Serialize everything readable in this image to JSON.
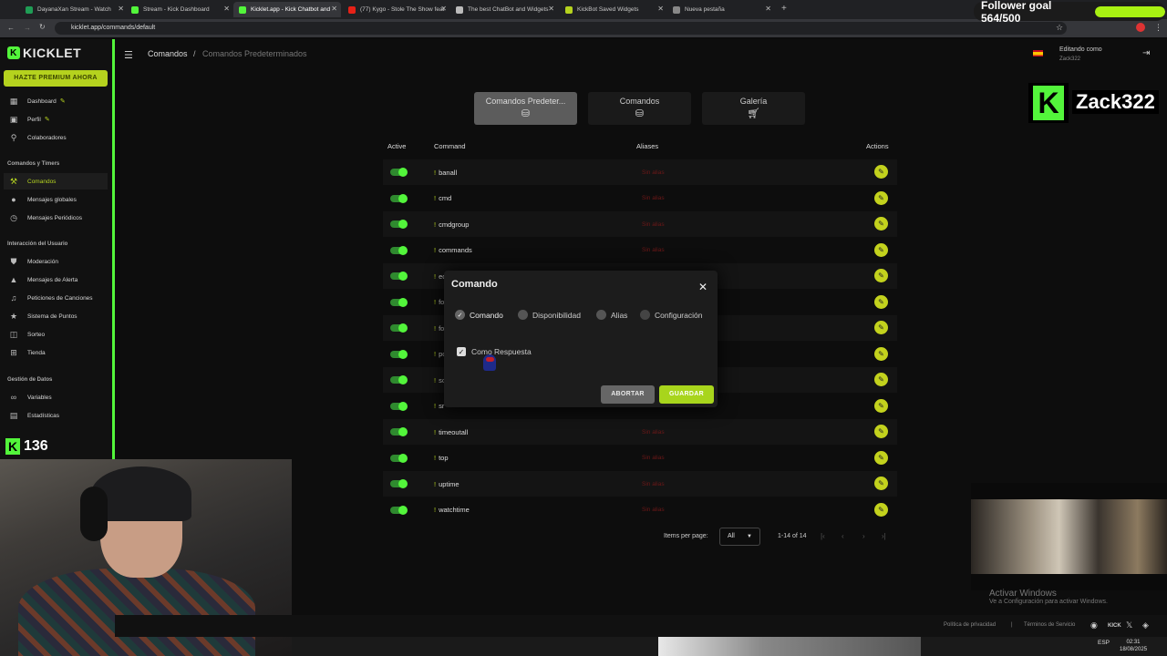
{
  "browser": {
    "tabs": [
      {
        "title": "DayanaXan Stream - Watch",
        "color": "#1f9d55"
      },
      {
        "title": "Stream - Kick Dashboard",
        "color": "#53f53b"
      },
      {
        "title": "Kicklet.app - Kick Chatbot and",
        "color": "#53f53b"
      },
      {
        "title": "(77) Kygo - Stole The Show feat",
        "color": "#e62117"
      },
      {
        "title": "The best ChatBot and Widgets",
        "color": "#bbbbbb"
      },
      {
        "title": "KickBot Saved Widgets",
        "color": "#b5d21e"
      },
      {
        "title": "Nueva pestaña",
        "color": "#888888"
      }
    ],
    "active_tab": 2,
    "url": "kicklet.app/commands/default"
  },
  "overlay": {
    "follower_goal_label": "Follower goal 564/500",
    "follower_goal_fraction": 1.0,
    "streamer_name": "Zack322",
    "kick_count": "136",
    "windows_activate_title": "Activar Windows",
    "windows_activate_sub": "Ve a Configuración para activar Windows."
  },
  "app": {
    "logo": "KICKLET",
    "premium_button": "HAZTE PREMIUM AHORA",
    "sidebar": {
      "items_top": [
        {
          "label": "Dashboard",
          "icon": "grid-icon"
        },
        {
          "label": "Perfil",
          "icon": "profile-icon"
        },
        {
          "label": "Colaboradores",
          "icon": "link-icon"
        }
      ],
      "section1": "Comandos y Timers",
      "items1": [
        {
          "label": "Comandos",
          "icon": "wrench-icon"
        },
        {
          "label": "Mensajes globales",
          "icon": "chat-icon"
        },
        {
          "label": "Mensajes Periódicos",
          "icon": "clock-icon"
        }
      ],
      "section2": "Interacción del Usuario",
      "items2": [
        {
          "label": "Moderación",
          "icon": "shield-icon"
        },
        {
          "label": "Mensajes de Alerta",
          "icon": "alert-icon"
        },
        {
          "label": "Peticiones de Canciones",
          "icon": "music-icon"
        },
        {
          "label": "Sistema de Puntos",
          "icon": "star-icon"
        },
        {
          "label": "Sorteo",
          "icon": "ticket-icon"
        },
        {
          "label": "Tienda",
          "icon": "cart-icon"
        }
      ],
      "section3": "Gestión de Datos",
      "items3": [
        {
          "label": "Variables",
          "icon": "variable-icon"
        },
        {
          "label": "Estadísticas",
          "icon": "stats-icon"
        }
      ]
    },
    "breadcrumb": {
      "root": "Comandos",
      "sep": "/",
      "current": "Comandos Predeterminados"
    },
    "user": {
      "editing_label": "Editando como",
      "username": "Zack322"
    },
    "top_tabs": [
      {
        "label": "Comandos Predeter...",
        "icon": "database-icon"
      },
      {
        "label": "Comandos",
        "icon": "database-icon"
      },
      {
        "label": "Galería",
        "icon": "cart-icon"
      }
    ],
    "table": {
      "headers": {
        "active": "Active",
        "command": "Command",
        "aliases": "Aliases",
        "actions": "Actions"
      },
      "prefix": "!",
      "no_alias": "Sin alias",
      "rows": [
        "banall",
        "cmd",
        "cmdgroup",
        "commands",
        "ec",
        "fo",
        "fo",
        "po",
        "so",
        "sr",
        "timeoutall",
        "top",
        "uptime",
        "watchtime"
      ],
      "hidden_alias_rows": [
        4,
        5,
        6,
        7,
        8,
        9
      ]
    },
    "pagination": {
      "label": "Items per page:",
      "value": "All",
      "range": "1-14 of 14"
    },
    "modal": {
      "title": "Comando",
      "steps": [
        "Comando",
        "Disponibilidad",
        "Alias",
        "Configuración"
      ],
      "checkbox_label": "Como Respuesta",
      "abort": "ABORTAR",
      "save": "GUARDAR"
    },
    "footer": {
      "privacy": "Política de privacidad",
      "sep": "|",
      "terms": "Términos de Servicio"
    }
  },
  "taskbar": {
    "lang": "ESP",
    "time": "02:31",
    "date": "18/08/2025"
  }
}
